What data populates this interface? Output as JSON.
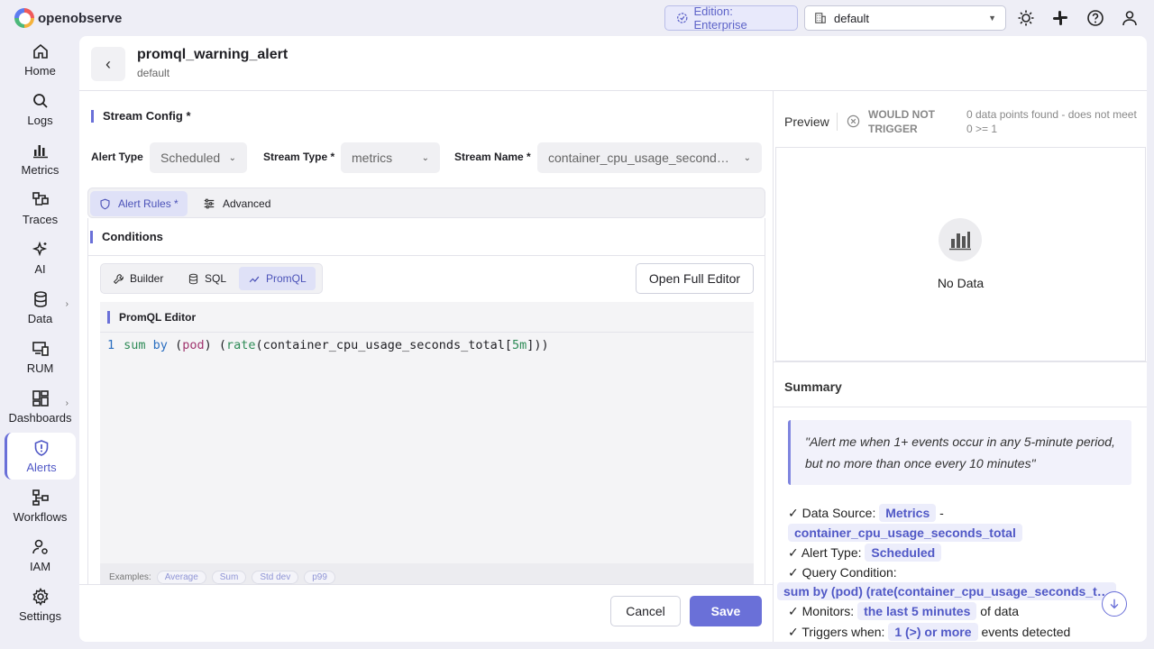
{
  "app": {
    "name": "openobserve"
  },
  "topbar": {
    "edition": "Edition: Enterprise",
    "org": "default"
  },
  "sidebar": {
    "items": [
      {
        "label": "Home",
        "icon": "home-icon"
      },
      {
        "label": "Logs",
        "icon": "search-icon"
      },
      {
        "label": "Metrics",
        "icon": "bar-chart-icon"
      },
      {
        "label": "Traces",
        "icon": "traces-icon"
      },
      {
        "label": "AI",
        "icon": "sparkle-icon"
      },
      {
        "label": "Data",
        "icon": "database-icon"
      },
      {
        "label": "RUM",
        "icon": "devices-icon"
      },
      {
        "label": "Dashboards",
        "icon": "dashboard-icon"
      },
      {
        "label": "Alerts",
        "icon": "alert-shield-icon"
      },
      {
        "label": "Workflows",
        "icon": "workflow-icon"
      },
      {
        "label": "IAM",
        "icon": "user-gear-icon"
      },
      {
        "label": "Settings",
        "icon": "gear-icon"
      }
    ]
  },
  "header": {
    "title": "promql_warning_alert",
    "subtitle": "default"
  },
  "stream_config": {
    "title": "Stream Config *",
    "alert_type_label": "Alert Type",
    "alert_type_value": "Scheduled",
    "stream_type_label": "Stream Type *",
    "stream_type_value": "metrics",
    "stream_name_label": "Stream Name *",
    "stream_name_value": "container_cpu_usage_second…"
  },
  "tabs": {
    "alert_rules": "Alert Rules *",
    "advanced": "Advanced"
  },
  "conditions": {
    "title": "Conditions",
    "builder": "Builder",
    "sql": "SQL",
    "promql": "PromQL",
    "open_full_editor": "Open Full Editor",
    "editor_title": "PromQL Editor",
    "line_number": "1",
    "examples_label": "Examples:",
    "examples": [
      "Average",
      "Sum",
      "Std dev",
      "p99"
    ]
  },
  "footer": {
    "cancel": "Cancel",
    "save": "Save"
  },
  "preview": {
    "title": "Preview",
    "status": "WOULD NOT TRIGGER",
    "info": "0 data points found - does not meet 0 >= 1",
    "no_data": "No Data"
  },
  "summary": {
    "title": "Summary",
    "quote": "\"Alert me when 1+ events occur in any 5-minute period, but no more than once every 10 minutes\"",
    "data_source_label": "✓ Data Source:",
    "data_source_type": "Metrics",
    "dash": "-",
    "data_source_stream": "container_cpu_usage_seconds_total",
    "alert_type_label": "✓ Alert Type:",
    "alert_type_value": "Scheduled",
    "query_label": "✓ Query Condition:",
    "query_value": "sum by (pod) (rate(container_cpu_usage_seconds_t…",
    "monitors_label": "✓ Monitors:",
    "monitors_value": "the last 5 minutes",
    "monitors_suffix": "of data",
    "triggers_label": "✓ Triggers when:",
    "triggers_value": "1 (>) or more",
    "triggers_suffix": "events detected"
  },
  "colors": {
    "accent": "#6a70d8",
    "background": "#eeeef6"
  }
}
